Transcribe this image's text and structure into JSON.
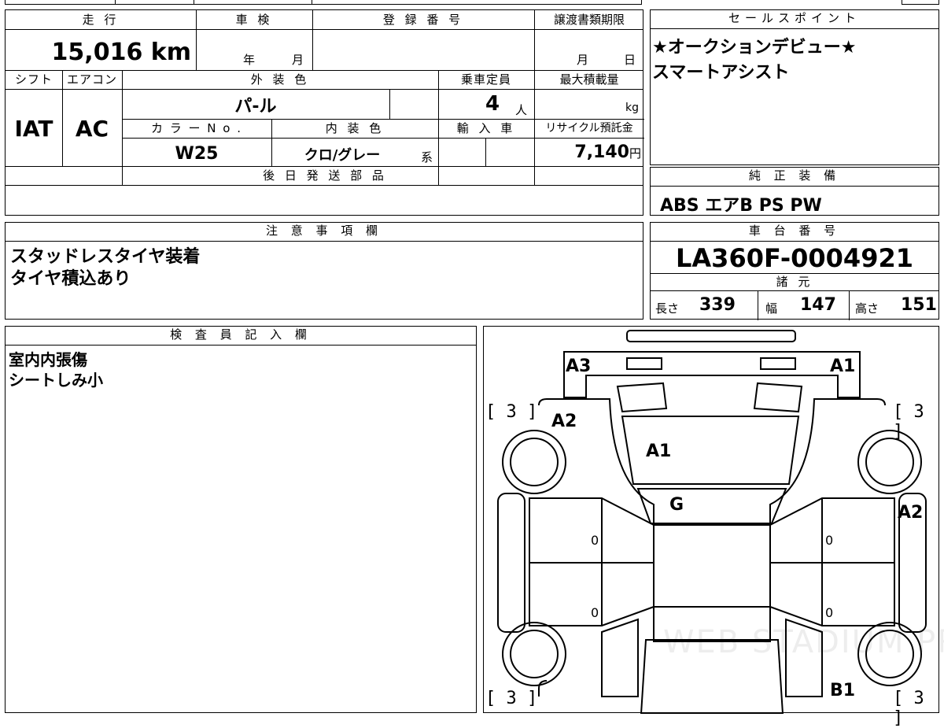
{
  "vehicle_info": {
    "mileage_label": "走 行",
    "mileage_value": "15,016",
    "mileage_unit": "km",
    "inspection_label": "車 検",
    "inspection_year_unit": "年",
    "inspection_month_unit": "月",
    "registration_label": "登 録 番 号",
    "transfer_deadline_label": "譲渡書類期限",
    "transfer_month_unit": "月",
    "transfer_day_unit": "日",
    "shift_label": "シフト",
    "shift_value": "IAT",
    "ac_label": "エアコン",
    "ac_value": "AC",
    "exterior_color_label": "外 装 色",
    "exterior_color_value": "パ-ル",
    "capacity_label": "乗車定員",
    "capacity_value": "4",
    "capacity_unit": "人",
    "max_load_label": "最大積載量",
    "max_load_unit": "kg",
    "color_no_label": "カ ラ ー N o .",
    "color_no_value": "W25",
    "interior_color_label": "内 装 色",
    "interior_color_value": "クロ/グレー",
    "interior_color_suffix": "系",
    "import_label": "輸 入 車",
    "recycle_label": "リサイクル預託金",
    "recycle_value": "7,140",
    "recycle_unit": "円",
    "later_parts_label": "後 日 発 送 部 品"
  },
  "sales_point": {
    "label": "セールスポイント",
    "lines": [
      "★オークションデビュー★",
      "スマートアシスト"
    ]
  },
  "equipment": {
    "label": "純 正 装 備",
    "value": "ABS エアB PS PW"
  },
  "notes": {
    "label": "注 意 事 項 欄",
    "lines": [
      "スタッドレスタイヤ装着",
      "タイヤ積込あり"
    ]
  },
  "chassis": {
    "label": "車 台 番 号",
    "value": "LA360F-0004921",
    "spec_label": "諸 元",
    "length_label": "長さ",
    "length_value": "339",
    "width_label": "幅",
    "width_value": "147",
    "height_label": "高さ",
    "height_value": "151"
  },
  "inspector": {
    "label": "検 査 員 記 入 欄",
    "lines": [
      "室内内張傷",
      "シートしみ小"
    ]
  },
  "diagram": {
    "marks": {
      "a3_front_left": "A3",
      "a1_front_right": "A1",
      "a2_left_fender": "A2",
      "a1_hood": "A1",
      "g_windshield": "G",
      "a2_right_side": "A2",
      "b1_rear_right": "B1",
      "door_fl": "0",
      "door_rl": "0",
      "door_fr": "0",
      "door_rr": "0"
    },
    "tire_front_left": "[ 3 ]",
    "tire_front_right": "[ 3 ]",
    "tire_rear_left": "[ 3 ]",
    "tire_rear_right": "[ 3 ]",
    "watermark": "WEB STADIUM PRO"
  }
}
